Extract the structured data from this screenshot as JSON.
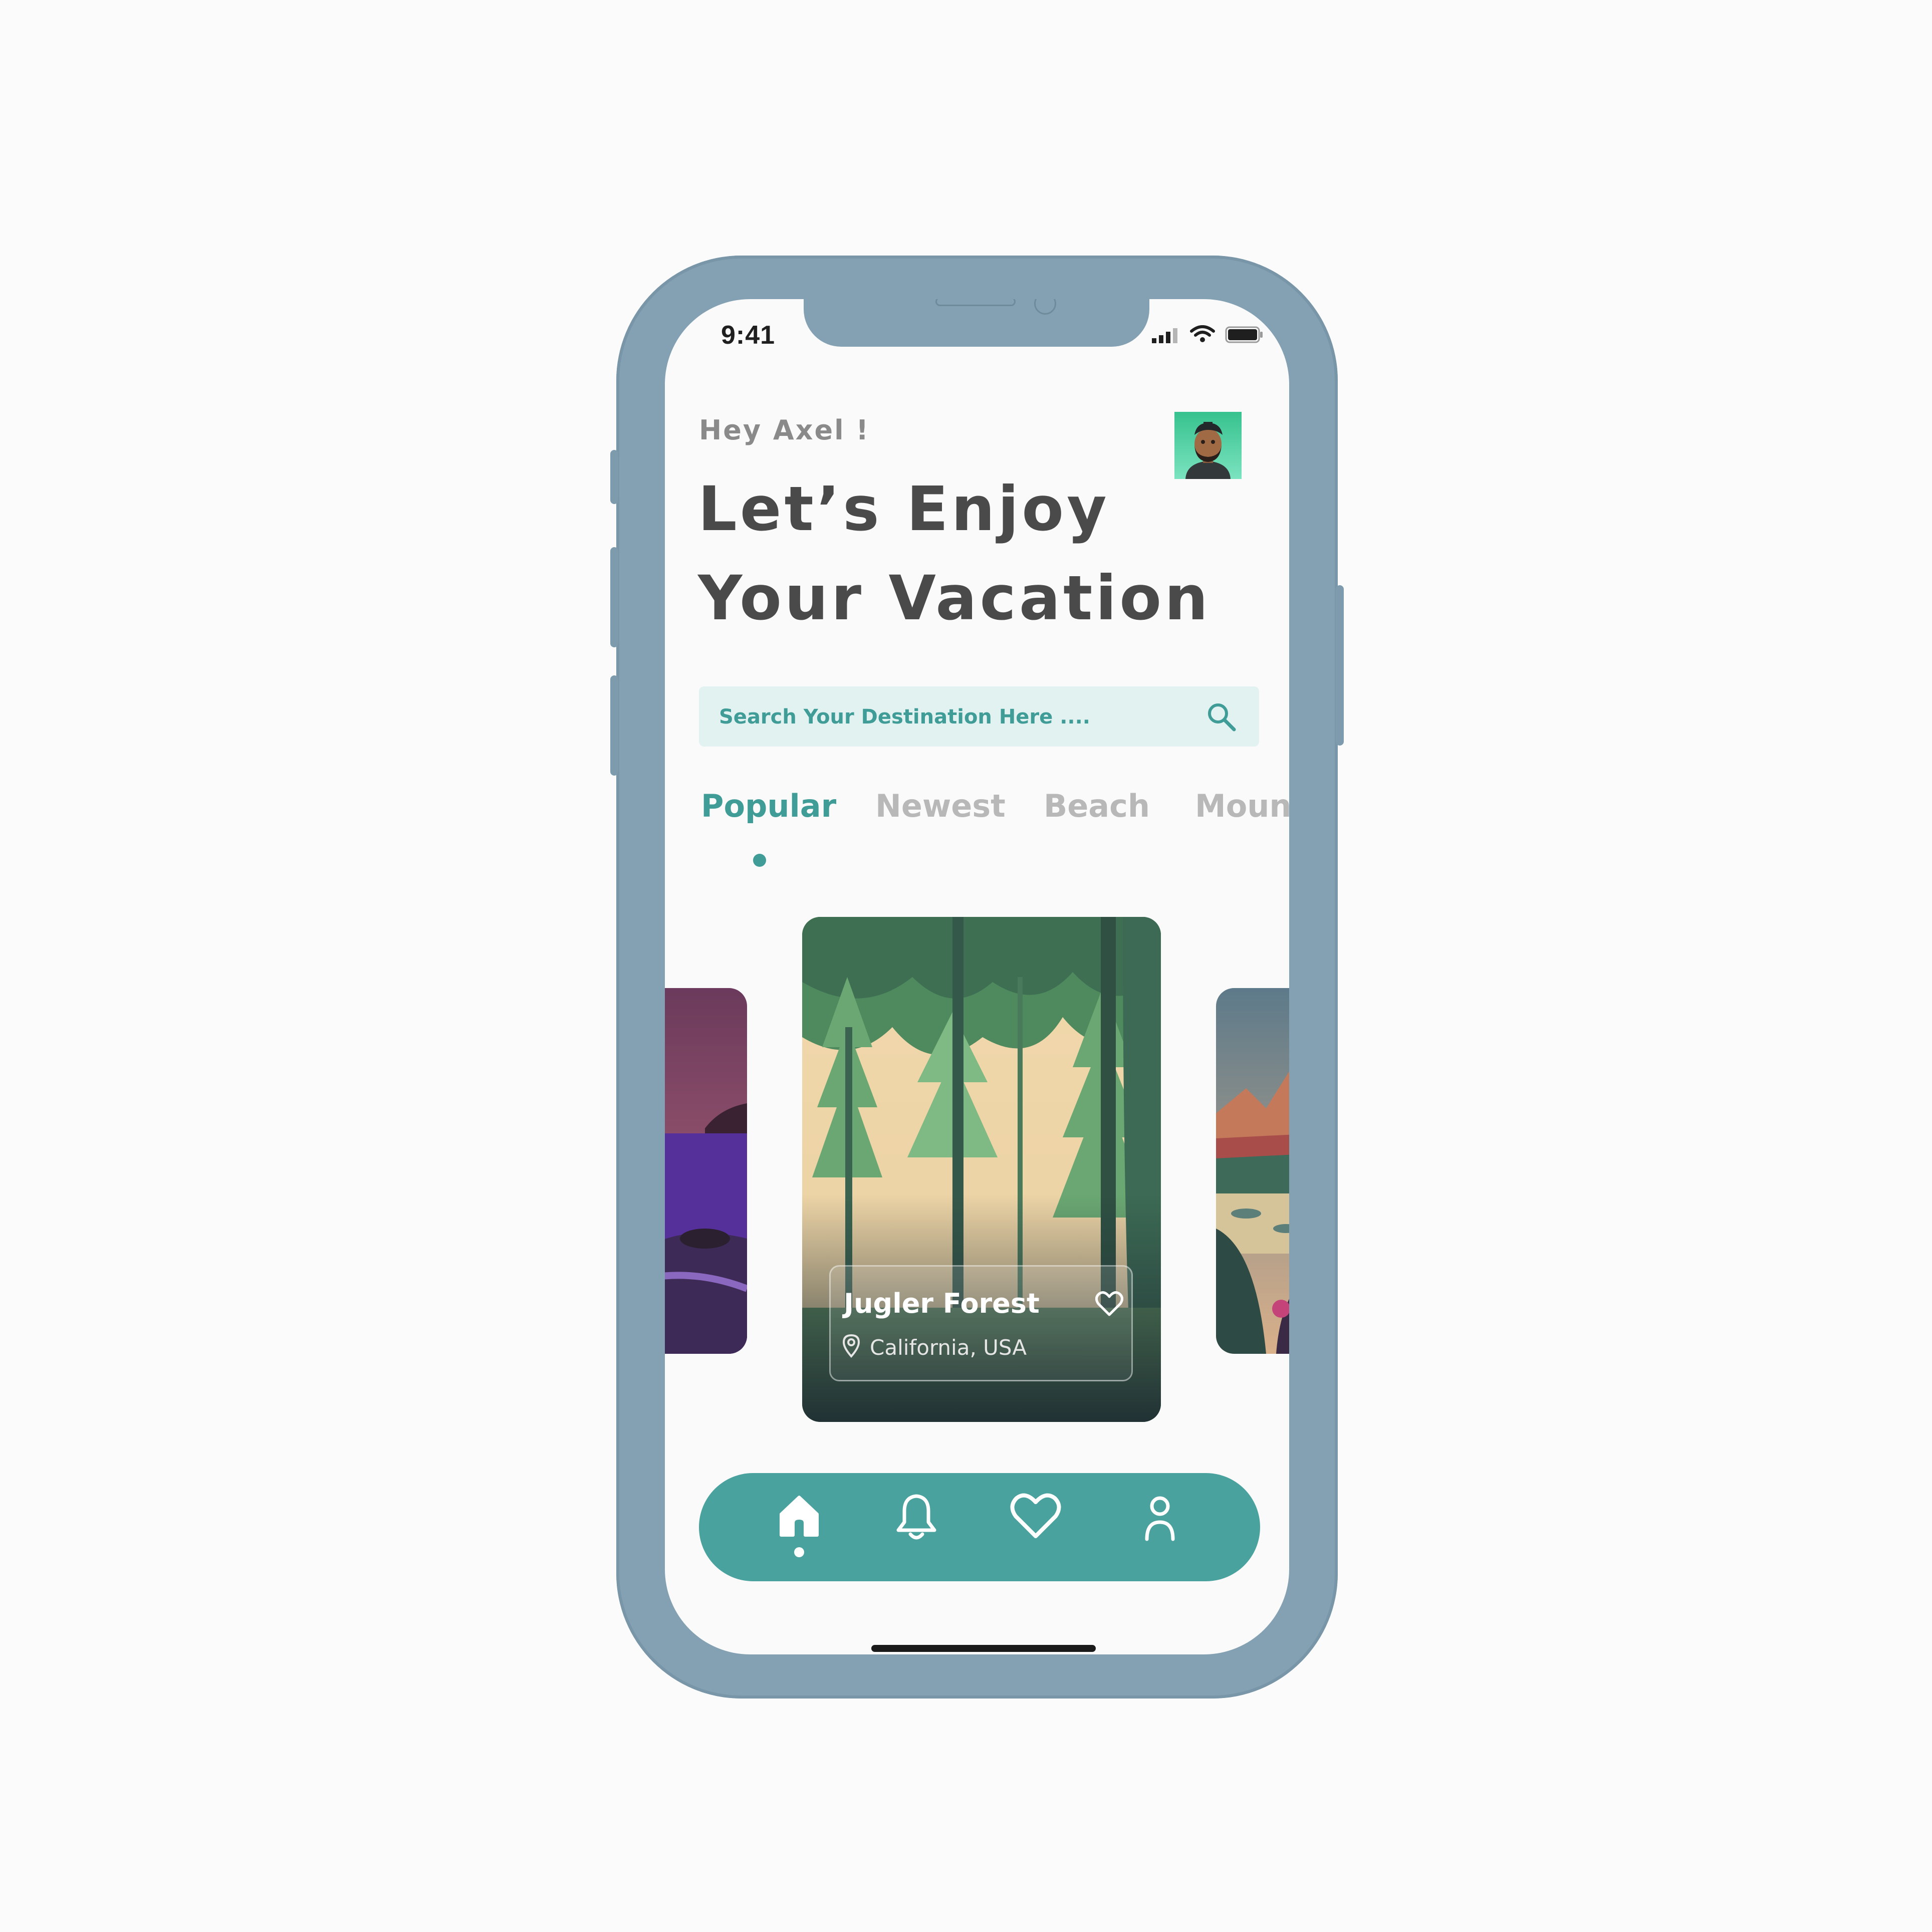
{
  "status_bar": {
    "time": "9:41"
  },
  "header": {
    "greeting": "Hey Axel !",
    "headline_line1": "Let’s Enjoy",
    "headline_line2": "Your Vacation"
  },
  "search": {
    "placeholder": "Search Your Destination Here ...."
  },
  "tabs": [
    {
      "label": "Popular",
      "active": true
    },
    {
      "label": "Newest"
    },
    {
      "label": "Beach"
    },
    {
      "label": "Mount"
    }
  ],
  "featured_card": {
    "title": "Jugler Forest",
    "location": "California, USA"
  },
  "bottom_nav": {
    "items": [
      "home-icon",
      "bell-icon",
      "heart-icon",
      "user-icon"
    ],
    "active": "home-icon"
  },
  "colors": {
    "accent": "#4aa29e",
    "phone_frame": "#83a1b2",
    "heading": "#4a4a4a",
    "search_bg": "#e2f2f1"
  }
}
